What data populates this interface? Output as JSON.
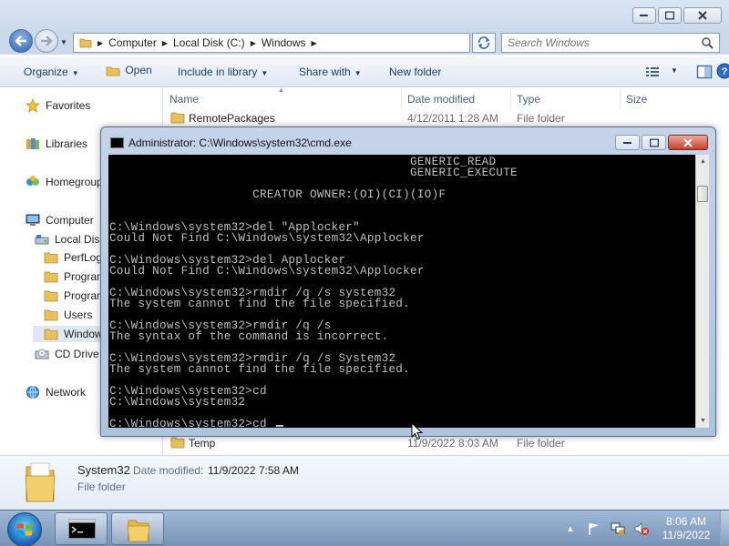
{
  "explorer": {
    "breadcrumbs": [
      "Computer",
      "Local Disk (C:)",
      "Windows"
    ],
    "search_placeholder": "Search Windows",
    "toolbar": {
      "organize": "Organize",
      "open": "Open",
      "include_library": "Include in library",
      "share_with": "Share with",
      "new_folder": "New folder"
    },
    "nav": {
      "favorites": "Favorites",
      "libraries": "Libraries",
      "homegroup": "Homegroup",
      "computer": "Computer",
      "local_disk": "Local Disk",
      "perflogs": "PerfLog",
      "program_files": "Program",
      "program_files_x86": "Program",
      "users": "Users",
      "windows": "Window",
      "cd_drive": "CD Drive",
      "network": "Network"
    },
    "columns": {
      "name": "Name",
      "date_modified": "Date modified",
      "type": "Type",
      "size": "Size"
    },
    "files": [
      {
        "name": "RemotePackages",
        "date": "4/12/2011 1:28 AM",
        "type": "File folder"
      },
      {
        "name": "Temp",
        "date": "11/9/2022 8:03 AM",
        "type": "File folder"
      }
    ],
    "details": {
      "name": "System32",
      "date_label": "Date modified:",
      "date_value": "11/9/2022 7:58 AM",
      "type": "File folder"
    }
  },
  "cmd": {
    "title": "Administrator: C:\\Windows\\system32\\cmd.exe",
    "lines": [
      "                                          GENERIC_READ",
      "                                          GENERIC_EXECUTE",
      "",
      "                    CREATOR OWNER:(OI)(CI)(IO)F",
      "",
      "",
      "C:\\Windows\\system32>del \"Applocker\"",
      "Could Not Find C:\\Windows\\system32\\Applocker",
      "",
      "C:\\Windows\\system32>del Applocker",
      "Could Not Find C:\\Windows\\system32\\Applocker",
      "",
      "C:\\Windows\\system32>rmdir /q /s system32",
      "The system cannot find the file specified.",
      "",
      "C:\\Windows\\system32>rmdir /q /s",
      "The syntax of the command is incorrect.",
      "",
      "C:\\Windows\\system32>rmdir /q /s System32",
      "The system cannot find the file specified.",
      "",
      "C:\\Windows\\system32>cd",
      "C:\\Windows\\system32",
      ""
    ],
    "prompt_line": "C:\\Windows\\system32>cd "
  },
  "taskbar": {
    "clock_time": "8:06 AM",
    "clock_date": "11/9/2022"
  }
}
